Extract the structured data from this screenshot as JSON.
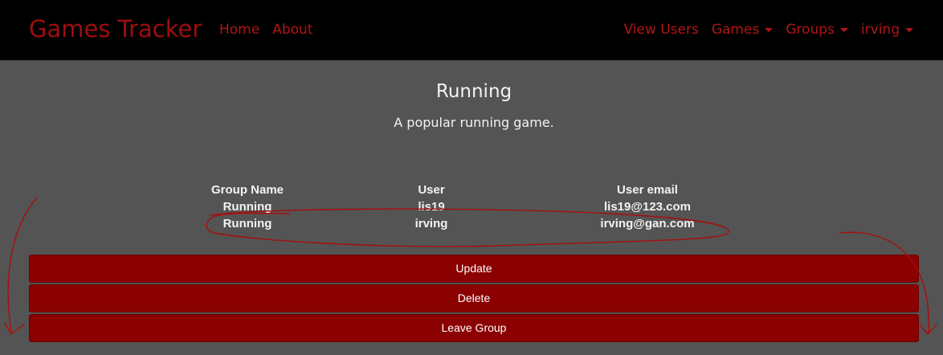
{
  "navbar": {
    "brand": "Games Tracker",
    "left_links": [
      "Home",
      "About"
    ],
    "right_links": [
      {
        "label": "View Users",
        "dropdown": false
      },
      {
        "label": "Games",
        "dropdown": true
      },
      {
        "label": "Groups",
        "dropdown": true
      },
      {
        "label": "irving",
        "dropdown": true
      }
    ]
  },
  "game": {
    "title": "Running",
    "description": "A popular running game."
  },
  "members_table": {
    "headers": [
      "Group Name",
      "User",
      "User email"
    ],
    "rows": [
      [
        "Running",
        "lis19",
        "lis19@123.com"
      ],
      [
        "Running",
        "irving",
        "irving@gan.com"
      ]
    ]
  },
  "actions": {
    "update_label": "Update",
    "delete_label": "Delete",
    "leave_label": "Leave Group"
  },
  "colors": {
    "navbar_bg": "#000000",
    "brand": "#a00d0d",
    "nav_link": "#b31515",
    "page_bg": "#545454",
    "button_bg": "#8b0000",
    "annotation": "#a80d0d"
  }
}
